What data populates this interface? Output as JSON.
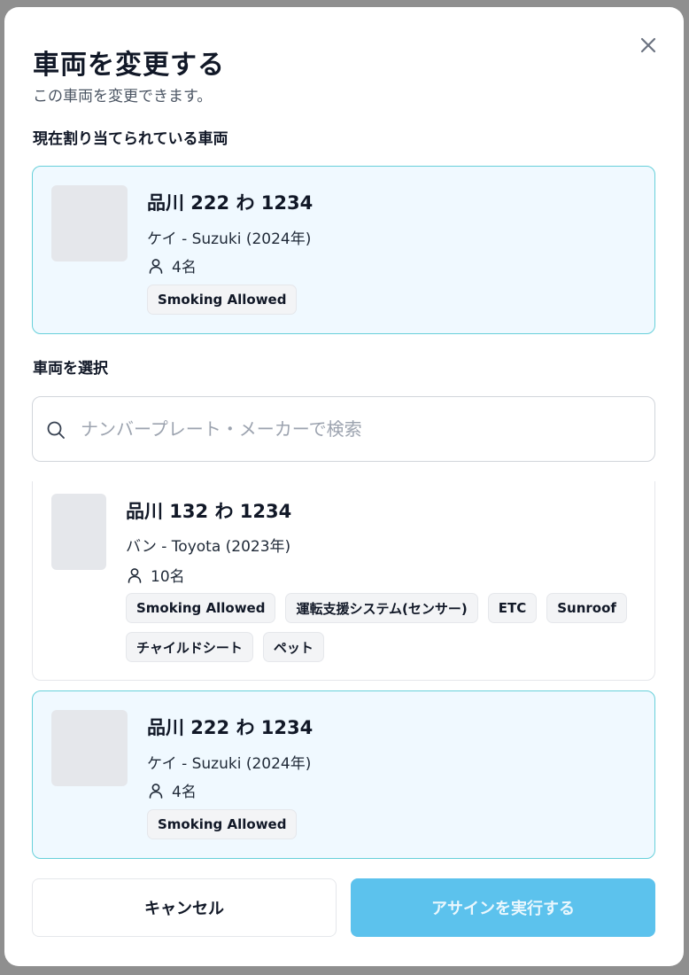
{
  "modal": {
    "title": "車両を変更する",
    "subtitle": "この車両を変更できます。"
  },
  "current": {
    "label": "現在割り当てられている車両",
    "vehicle": {
      "plate": "品川 222 わ 1234",
      "model": "ケイ - Suzuki (2024年)",
      "capacity": "4名",
      "tags": [
        "Smoking Allowed"
      ]
    }
  },
  "select": {
    "label": "車両を選択",
    "search_placeholder": "ナンバープレート・メーカーで検索"
  },
  "vehicles": [
    {
      "plate": "品川 132 わ 1234",
      "model": "バン - Toyota (2023年)",
      "capacity": "10名",
      "tags": [
        "Smoking Allowed",
        "運転支援システム(センサー)",
        "ETC",
        "Sunroof",
        "チャイルドシート",
        "ペット"
      ],
      "selected": false
    },
    {
      "plate": "品川 222 わ 1234",
      "model": "ケイ - Suzuki (2024年)",
      "capacity": "4名",
      "tags": [
        "Smoking Allowed"
      ],
      "selected": true
    }
  ],
  "actions": {
    "cancel": "キャンセル",
    "assign": "アサインを実行する"
  },
  "colors": {
    "accent": "#5cc2ed",
    "selected_bg": "#f0f9ff",
    "selected_border": "#67d0da"
  }
}
